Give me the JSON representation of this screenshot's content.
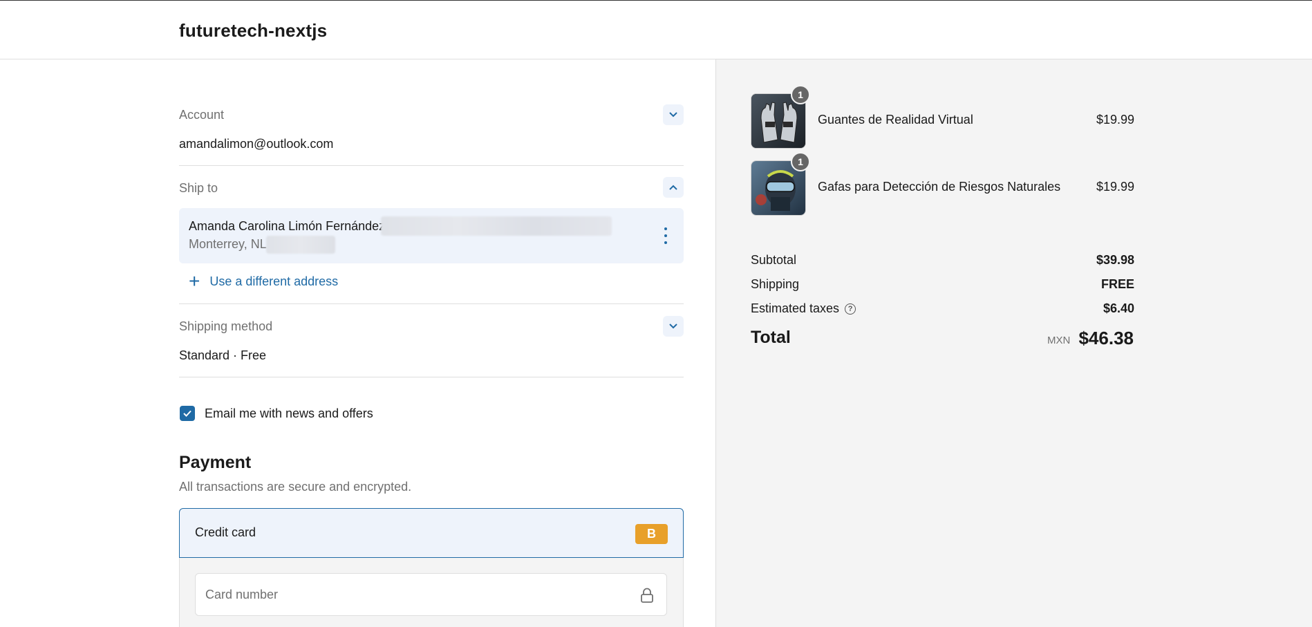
{
  "header": {
    "brand": "futuretech-nextjs"
  },
  "account": {
    "label": "Account",
    "email": "amandalimon@outlook.com"
  },
  "ship_to": {
    "label": "Ship to",
    "name": "Amanda Carolina Limón Fernández,",
    "city": "Monterrey, NL,",
    "use_different_address": "Use a different address"
  },
  "shipping_method": {
    "label": "Shipping method",
    "value": "Standard · Free"
  },
  "newsletter": {
    "label": "Email me with news and offers",
    "checked": true
  },
  "payment": {
    "title": "Payment",
    "subtitle": "All transactions are secure and encrypted.",
    "method_label": "Credit card",
    "method_badge": "B",
    "card_number_placeholder": "Card number"
  },
  "cart": {
    "items": [
      {
        "name": "Guantes de Realidad Virtual",
        "price": "$19.99",
        "qty": "1"
      },
      {
        "name": "Gafas para Detección de Riesgos Naturales",
        "price": "$19.99",
        "qty": "1"
      }
    ]
  },
  "summary": {
    "subtotal_label": "Subtotal",
    "subtotal": "$39.98",
    "shipping_label": "Shipping",
    "shipping": "FREE",
    "taxes_label": "Estimated taxes",
    "taxes": "$6.40",
    "total_label": "Total",
    "currency": "MXN",
    "total": "$46.38"
  },
  "colors": {
    "accent": "#1f6aa5",
    "badge": "#e8a02a",
    "panel_bg": "#f4f4f4",
    "selected_bg": "#eef3fb"
  }
}
